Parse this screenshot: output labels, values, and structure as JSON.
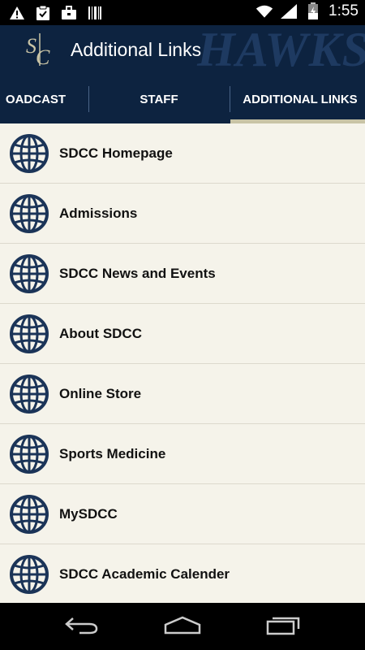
{
  "status_bar": {
    "time": "1:55",
    "left_icons": [
      "warning-icon",
      "clipboard-check-icon",
      "briefcase-icon",
      "barcode-icon"
    ],
    "right_icons": [
      "wifi-icon",
      "signal-icon",
      "battery-charging-icon"
    ]
  },
  "app_bar": {
    "logo_text": "SC",
    "title": "Additional Links",
    "watermark": "HAWKS"
  },
  "tabs": [
    {
      "label": "OADCAST",
      "selected": false
    },
    {
      "label": "STAFF",
      "selected": false
    },
    {
      "label": "ADDITIONAL LINKS",
      "selected": true
    }
  ],
  "links": [
    {
      "label": "SDCC Homepage",
      "icon": "globe-icon"
    },
    {
      "label": "Admissions",
      "icon": "globe-icon"
    },
    {
      "label": "SDCC News and Events",
      "icon": "globe-icon"
    },
    {
      "label": "About SDCC",
      "icon": "globe-icon"
    },
    {
      "label": "Online Store",
      "icon": "globe-icon"
    },
    {
      "label": "Sports Medicine",
      "icon": "globe-icon"
    },
    {
      "label": "MySDCC",
      "icon": "globe-icon"
    },
    {
      "label": "SDCC Academic Calender",
      "icon": "globe-icon"
    }
  ],
  "nav_bar": {
    "buttons": [
      "back-icon",
      "home-icon",
      "recent-apps-icon"
    ]
  },
  "colors": {
    "header": "#0d2340",
    "list_background": "#f5f3ea",
    "tab_indicator": "#c9c4a6",
    "globe": "#1b3458"
  }
}
